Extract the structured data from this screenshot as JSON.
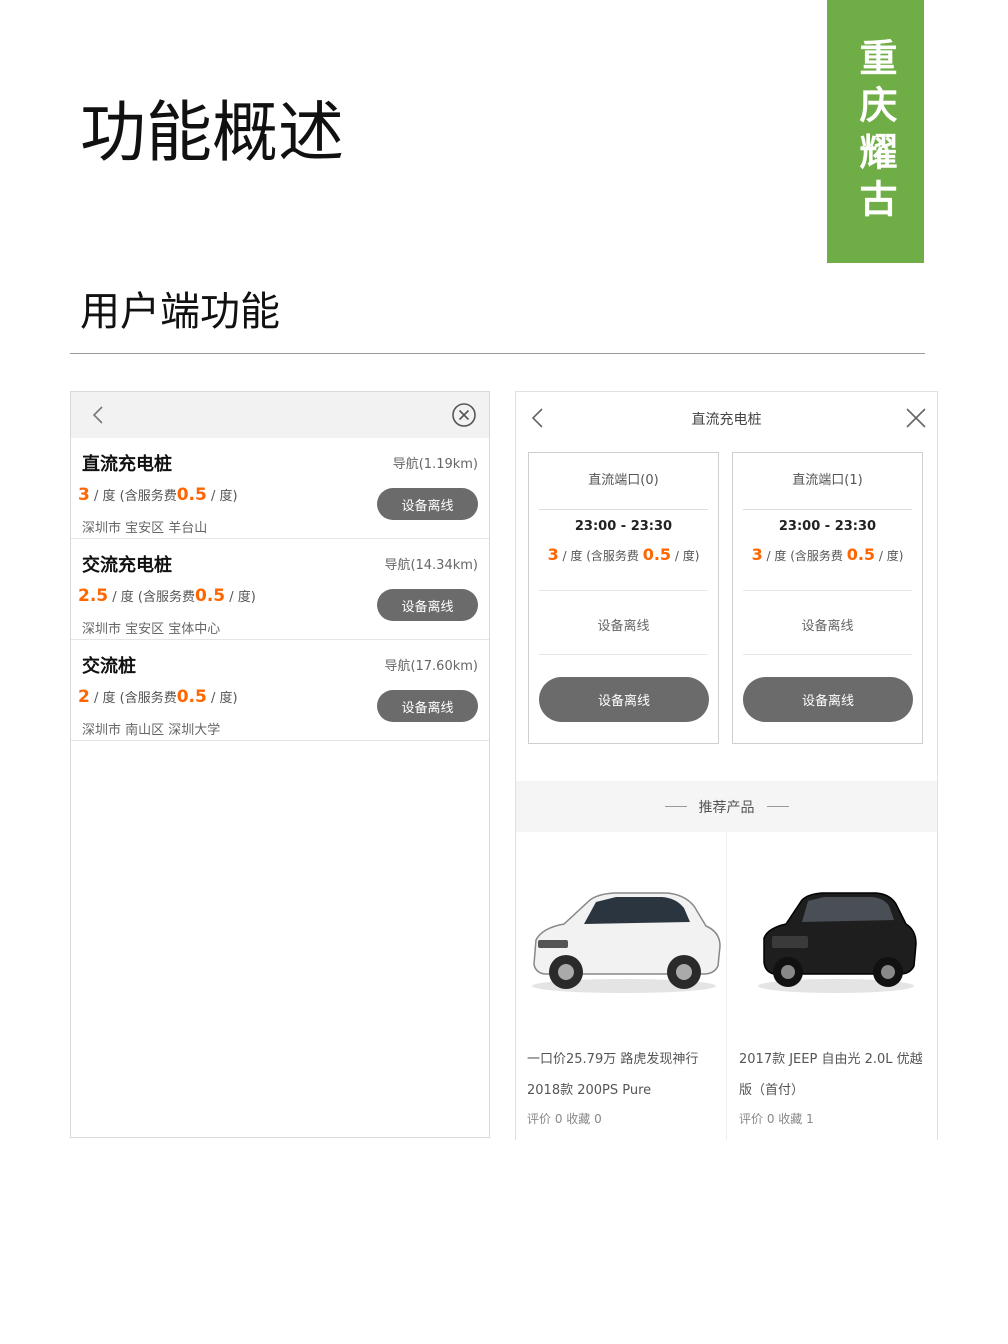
{
  "brand": {
    "name": "重庆耀古",
    "color": "#6fad46"
  },
  "page": {
    "title": "功能概述",
    "section_title": "用户端功能"
  },
  "left_panel": {
    "stations": [
      {
        "name": "直流充电桩",
        "nav": "导航(1.19km)",
        "price": "3",
        "price_unit": " / 度 (含服务费",
        "service_fee": "0.5",
        "service_unit": " / 度)",
        "address": "深圳市 宝安区 羊台山",
        "button": "设备离线"
      },
      {
        "name": "交流充电桩",
        "nav": "导航(14.34km)",
        "price": "2.5",
        "price_unit": " / 度 (含服务费",
        "service_fee": "0.5",
        "service_unit": " / 度)",
        "address": "深圳市 宝安区 宝体中心",
        "button": "设备离线"
      },
      {
        "name": "交流桩",
        "nav": "导航(17.60km)",
        "price": "2",
        "price_unit": " / 度 (含服务费",
        "service_fee": "0.5",
        "service_unit": " / 度)",
        "address": "深圳市 南山区 深圳大学",
        "button": "设备离线"
      }
    ]
  },
  "right_panel": {
    "title": "直流充电桩",
    "ports": [
      {
        "name": "直流端口(0)",
        "time": "23:00 - 23:30",
        "price": "3",
        "price_unit": " / 度 (含服务费 ",
        "service_fee": "0.5",
        "service_unit": " / 度)",
        "status": "设备离线",
        "button": "设备离线"
      },
      {
        "name": "直流端口(1)",
        "time": "23:00 - 23:30",
        "price": "3",
        "price_unit": " / 度 (含服务费 ",
        "service_fee": "0.5",
        "service_unit": " / 度)",
        "status": "设备离线",
        "button": "设备离线"
      }
    ],
    "recommend_label": "推荐产品",
    "products": [
      {
        "title": "一口价25.79万 路虎发现神行2018款 200PS Pure",
        "stats": "评价 0  收藏 0",
        "car_color": "#f2f2f2",
        "image": "white-suv-image"
      },
      {
        "title": "2017款 JEEP 自由光 2.0L 优越版（首付）",
        "stats": "评价 0  收藏 1",
        "car_color": "#1e1e1e",
        "image": "black-suv-image"
      }
    ]
  },
  "colors": {
    "accent_price": "#ff6600",
    "button_gray": "#6b6b6b"
  }
}
